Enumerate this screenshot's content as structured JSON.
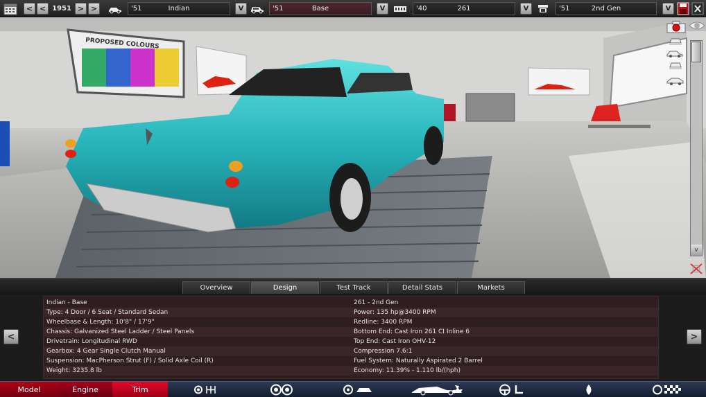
{
  "topbar": {
    "year": "1951",
    "prev2": "<",
    "prev1": "<",
    "next1": ">",
    "next2": ">",
    "model": {
      "year": "'51",
      "name": "Indian"
    },
    "trim": {
      "year": "'51",
      "name": "Base"
    },
    "engine": {
      "year": "'40",
      "name": "261"
    },
    "engine_variant": {
      "year": "'51",
      "name": "2nd Gen"
    },
    "dropdown_label": "V"
  },
  "tabs": [
    "Overview",
    "Design",
    "Test Track",
    "Detail Stats",
    "Markets"
  ],
  "active_tab": "Design",
  "info": {
    "left": [
      "Indian - Base",
      "Type: 4 Door / 6 Seat / Standard Sedan",
      "Wheelbase & Length: 10'8\" / 17'9\"",
      "Chassis: Galvanized Steel Ladder / Steel Panels",
      "Drivetrain: Longitudinal RWD",
      "Gearbox: 4 Gear Single Clutch Manual",
      "Suspension: MacPherson Strut (F) / Solid Axle Coil (R)",
      "Weight: 3235.8 lb"
    ],
    "right": [
      "261 - 2nd Gen",
      "Power: 135 hp@3400 RPM",
      "Redline: 3400 RPM",
      "Bottom End: Cast Iron 261 CI Inline 6",
      "Top End: Cast Iron OHV-12",
      "Compression 7.6:1",
      "Fuel System: Naturally Aspirated 2 Barrel",
      "Economy: 11.39% - 1.110 lb/(hph)"
    ],
    "prev": "<",
    "next": ">"
  },
  "viewport": {
    "poster_title": "PROPOSED COLOURS",
    "scroll_down": "v"
  },
  "bottomnav": {
    "model": "Model",
    "engine": "Engine",
    "trim": "Trim"
  }
}
